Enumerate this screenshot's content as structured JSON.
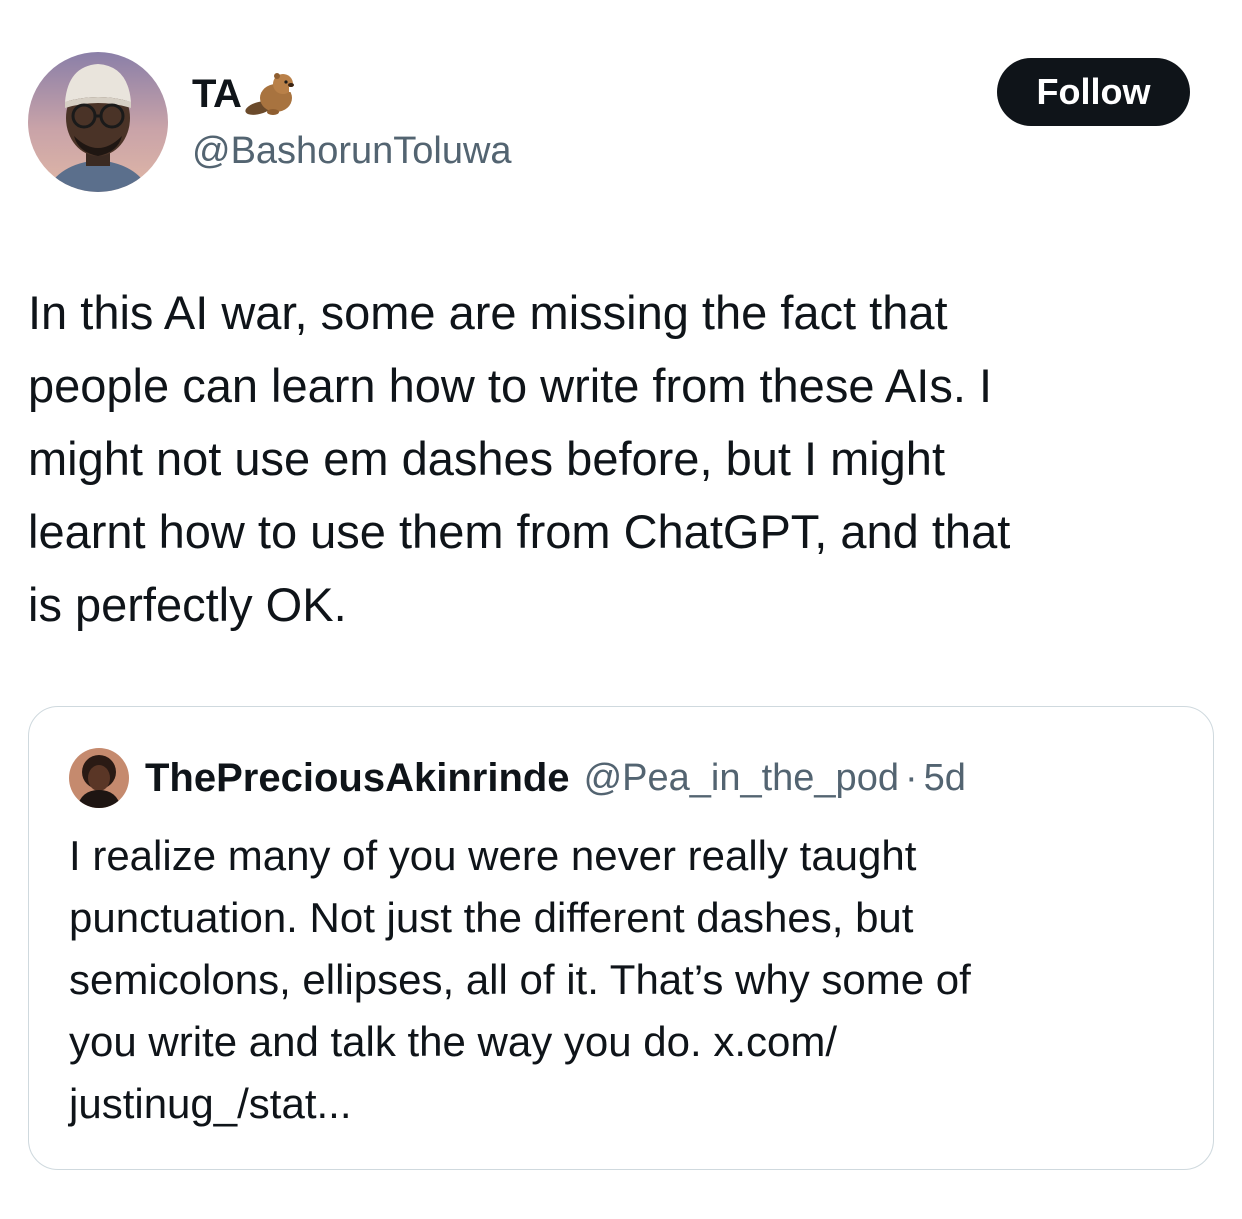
{
  "tweet": {
    "author": {
      "display_name": "TA",
      "name_emoji_icon": "beaver-icon",
      "handle": "@BashorunToluwa",
      "avatar_icon": "avatar-icon"
    },
    "follow_label": "Follow",
    "text": "In this AI war, some are missing the fact that\npeople can  learn how to write from these AIs. I\nmight not use em dashes before, but I might\nlearnt how to use them from ChatGPT, and that\nis perfectly OK."
  },
  "quote": {
    "author": {
      "display_name": "ThePreciousAkinrinde",
      "handle": "@Pea_in_the_pod",
      "separator": "·",
      "time": "5d"
    },
    "text": "I realize many of you were never really taught\npunctuation. Not just the different dashes, but\nsemicolons, ellipses, all of it. That’s why some of\nyou write and talk the way you do. x.com/\njustinug_/stat..."
  },
  "colors": {
    "text_primary": "#0f1419",
    "text_secondary": "#536471",
    "border": "#cfd9de",
    "follow_bg": "#0f1419",
    "follow_text": "#ffffff"
  }
}
